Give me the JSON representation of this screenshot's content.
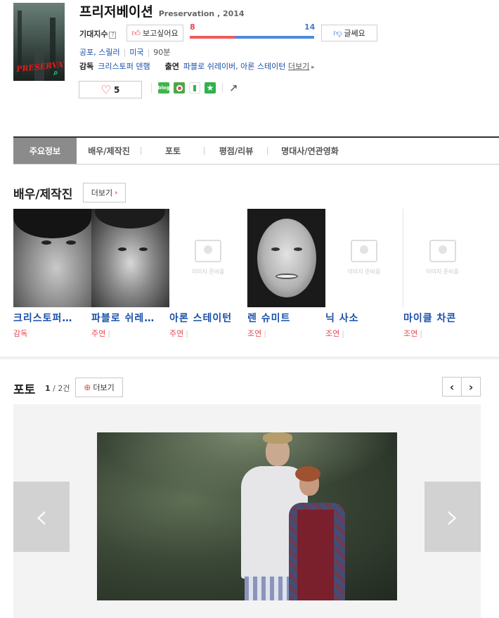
{
  "movie": {
    "title": "프리저베이션",
    "subtitle": "Preservation , 2014",
    "poster_text": "PRESERVATI",
    "expect_label": "기대지수",
    "expect_help": "?",
    "want_label": "보고싶어요",
    "doubt_label": "글쎄요",
    "want_count": "8",
    "doubt_count": "14",
    "want_ratio": 0.36,
    "genre": "공포, 스릴러",
    "country": "미국",
    "runtime": "90분",
    "director_label": "감독",
    "director": "크리스토퍼 덴햄",
    "cast_label": "출연",
    "cast": "파블로 쉬레이버, 아론 스테이턴",
    "more_label": "더보기",
    "like_count": "5",
    "share_icons": [
      "blog",
      "me2day",
      "twitter",
      "yozm"
    ]
  },
  "tabs": [
    "주요정보",
    "배우/제작진",
    "포토",
    "평점/리뷰",
    "명대사/연관영화"
  ],
  "cast_section": {
    "title": "배우/제작진",
    "more_label": "더보기",
    "no_image_text": "이미지 준비중",
    "people": [
      {
        "name": "크리스토퍼 덴햄",
        "display": "크리스토퍼…",
        "role": "감독",
        "has_photo": true
      },
      {
        "name": "파블로 쉬레이버",
        "display": "파블로 쉬레…",
        "role": "주연",
        "has_photo": true
      },
      {
        "name": "아론 스테이턴",
        "display": "아론 스테이턴",
        "role": "주연",
        "has_photo": false
      },
      {
        "name": "렌 슈미트",
        "display": "렌 슈미트",
        "role": "조연",
        "has_photo": true
      },
      {
        "name": "닉 사소",
        "display": "닉 사소",
        "role": "조연",
        "has_photo": false
      },
      {
        "name": "마이클 차콘",
        "display": "마이클 차콘",
        "role": "조연",
        "has_photo": false
      }
    ]
  },
  "photo_section": {
    "title": "포토",
    "current": "1",
    "total": "2건",
    "more_label": "더보기"
  },
  "colors": {
    "accent_red": "#e8464f",
    "accent_blue": "#4a7cd4",
    "link": "#1a4fa8",
    "tab_active": "#8b8b8b"
  }
}
